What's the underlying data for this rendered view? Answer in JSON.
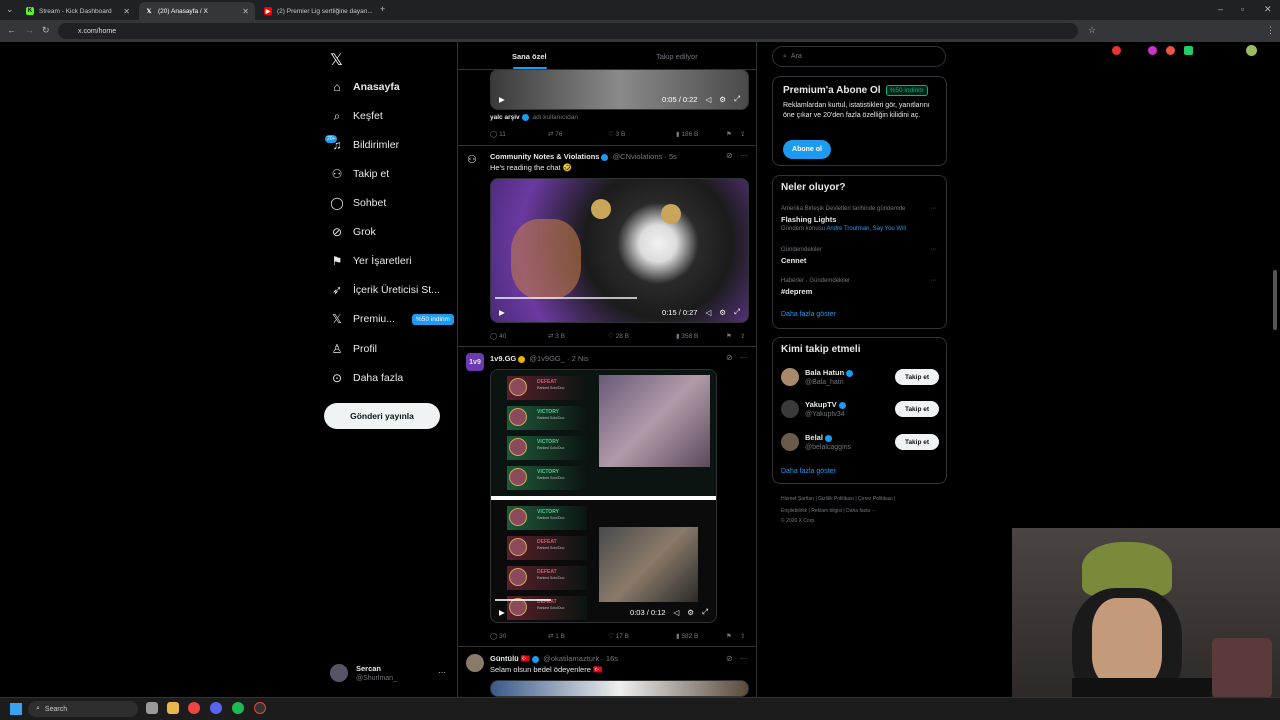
{
  "browser": {
    "tabs": [
      {
        "label": "Stream - Kick Dashboard",
        "favicon": "kick-icon",
        "color": "#53fc18"
      },
      {
        "label": "(20) Anasayfa / X",
        "favicon": "x-icon",
        "color": "#ffffff"
      },
      {
        "label": "(2) Premier Lig sertliğine dayan...",
        "favicon": "youtube-icon",
        "color": "#ff0000"
      }
    ],
    "url": "x.com/home"
  },
  "nav": {
    "items": [
      {
        "label": "Anasayfa",
        "icon": "home-icon"
      },
      {
        "label": "Keşfet",
        "icon": "search-icon"
      },
      {
        "label": "Bildirimler",
        "icon": "bell-icon",
        "badge": "20+"
      },
      {
        "label": "Takip et",
        "icon": "add-user-icon"
      },
      {
        "label": "Sohbet",
        "icon": "chat-icon"
      },
      {
        "label": "Grok",
        "icon": "grok-icon"
      },
      {
        "label": "Yer İşaretleri",
        "icon": "bookmark-icon"
      },
      {
        "label": "İçerik Üreticisi St...",
        "icon": "rocket-icon"
      },
      {
        "label": "Premiu...",
        "icon": "x-icon",
        "pill": "%50 indirim"
      },
      {
        "label": "Profil",
        "icon": "profile-icon"
      },
      {
        "label": "Daha fazla",
        "icon": "more-icon"
      }
    ],
    "post_button": "Gönderi yayınla",
    "account": {
      "name": "Sercan",
      "handle": "@Shurlman_"
    }
  },
  "feed": {
    "tabs": [
      "Sana özel",
      "Takip edilyor"
    ],
    "posts": [
      {
        "video_time": "0:05 / 0:22",
        "footer_name": "yalc arşiv",
        "footer_extra": "adı kullanıcıdan",
        "stats": {
          "replies": "11",
          "reposts": "76",
          "likes": "3 B",
          "views": "186 B"
        }
      },
      {
        "name": "Community Notes & Violations",
        "handle": "@CNviolations · 5s",
        "text": "He's reading the chat 🤣",
        "video_time": "0:15 / 0:27",
        "stats": {
          "replies": "40",
          "reposts": "3 B",
          "likes": "28 B",
          "views": "358 B"
        }
      },
      {
        "name": "1v9.GG",
        "handle": "@1v9GG_ · 2 Nis",
        "video_time": "0:03 / 0:12",
        "game_rows": [
          "DEFEAT",
          "VICTORY",
          "VICTORY",
          "VICTORY",
          "VICTORY",
          "DEFEAT",
          "DEFEAT",
          "DEFEAT"
        ],
        "game_sub": "Ranked Solo/Duo",
        "stats": {
          "replies": "30",
          "reposts": "1 B",
          "likes": "17 B",
          "views": "582 B"
        }
      },
      {
        "name": "Güntülü 🇹🇷",
        "handle": "@okatilamazturk · 16s",
        "text": "Selam olsun bedel ödeyenlere 🇹🇷"
      }
    ]
  },
  "right": {
    "search_placeholder": "Ara",
    "premium": {
      "title": "Premium'a Abone Ol",
      "badge": "%50 indirim",
      "body": "Reklamlardan kurtul, istatistikleri gör, yanıtlarını öne çıkar ve 20'den fazla özelliğin kilidini aç.",
      "button": "Abone ol"
    },
    "trends": {
      "title": "Neler oluyor?",
      "items": [
        {
          "meta": "Amerika Birleşik Devletleri tarihinde gündemde",
          "name": "Flashing Lights",
          "extra_label": "Gündem konusu",
          "extra_links": "Andre Troutman, Say You Will"
        },
        {
          "meta": "Gündemdekiler",
          "name": "Cennet"
        },
        {
          "meta": "Haberler · Gündemdekiler",
          "name": "#deprem"
        }
      ],
      "more": "Daha fazla göster"
    },
    "who_to_follow": {
      "title": "Kimi takip etmeli",
      "items": [
        {
          "name": "Bala Hatun",
          "handle": "@Bala_hatn",
          "button": "Takip et"
        },
        {
          "name": "YakupTV",
          "handle": "@Yakuptv34",
          "button": "Takip et"
        },
        {
          "name": "Belal",
          "handle": "@belalcaggins",
          "button": "Takip et"
        }
      ],
      "more": "Daha fazla göster"
    },
    "footer": {
      "line1": "Hizmet Şartları  |  Gizlilik Politikası  |  Çerez Politikası  |",
      "line2": "Erişilebilirlik  |  Reklam bilgisi  |  Daha fazla ···",
      "line3": "© 2026 X Corp."
    }
  },
  "taskbar": {
    "search": "Search"
  },
  "colors": {
    "accent": "#1d9bf0",
    "verified": "#1d9bf0",
    "green": "#00ba7c"
  }
}
